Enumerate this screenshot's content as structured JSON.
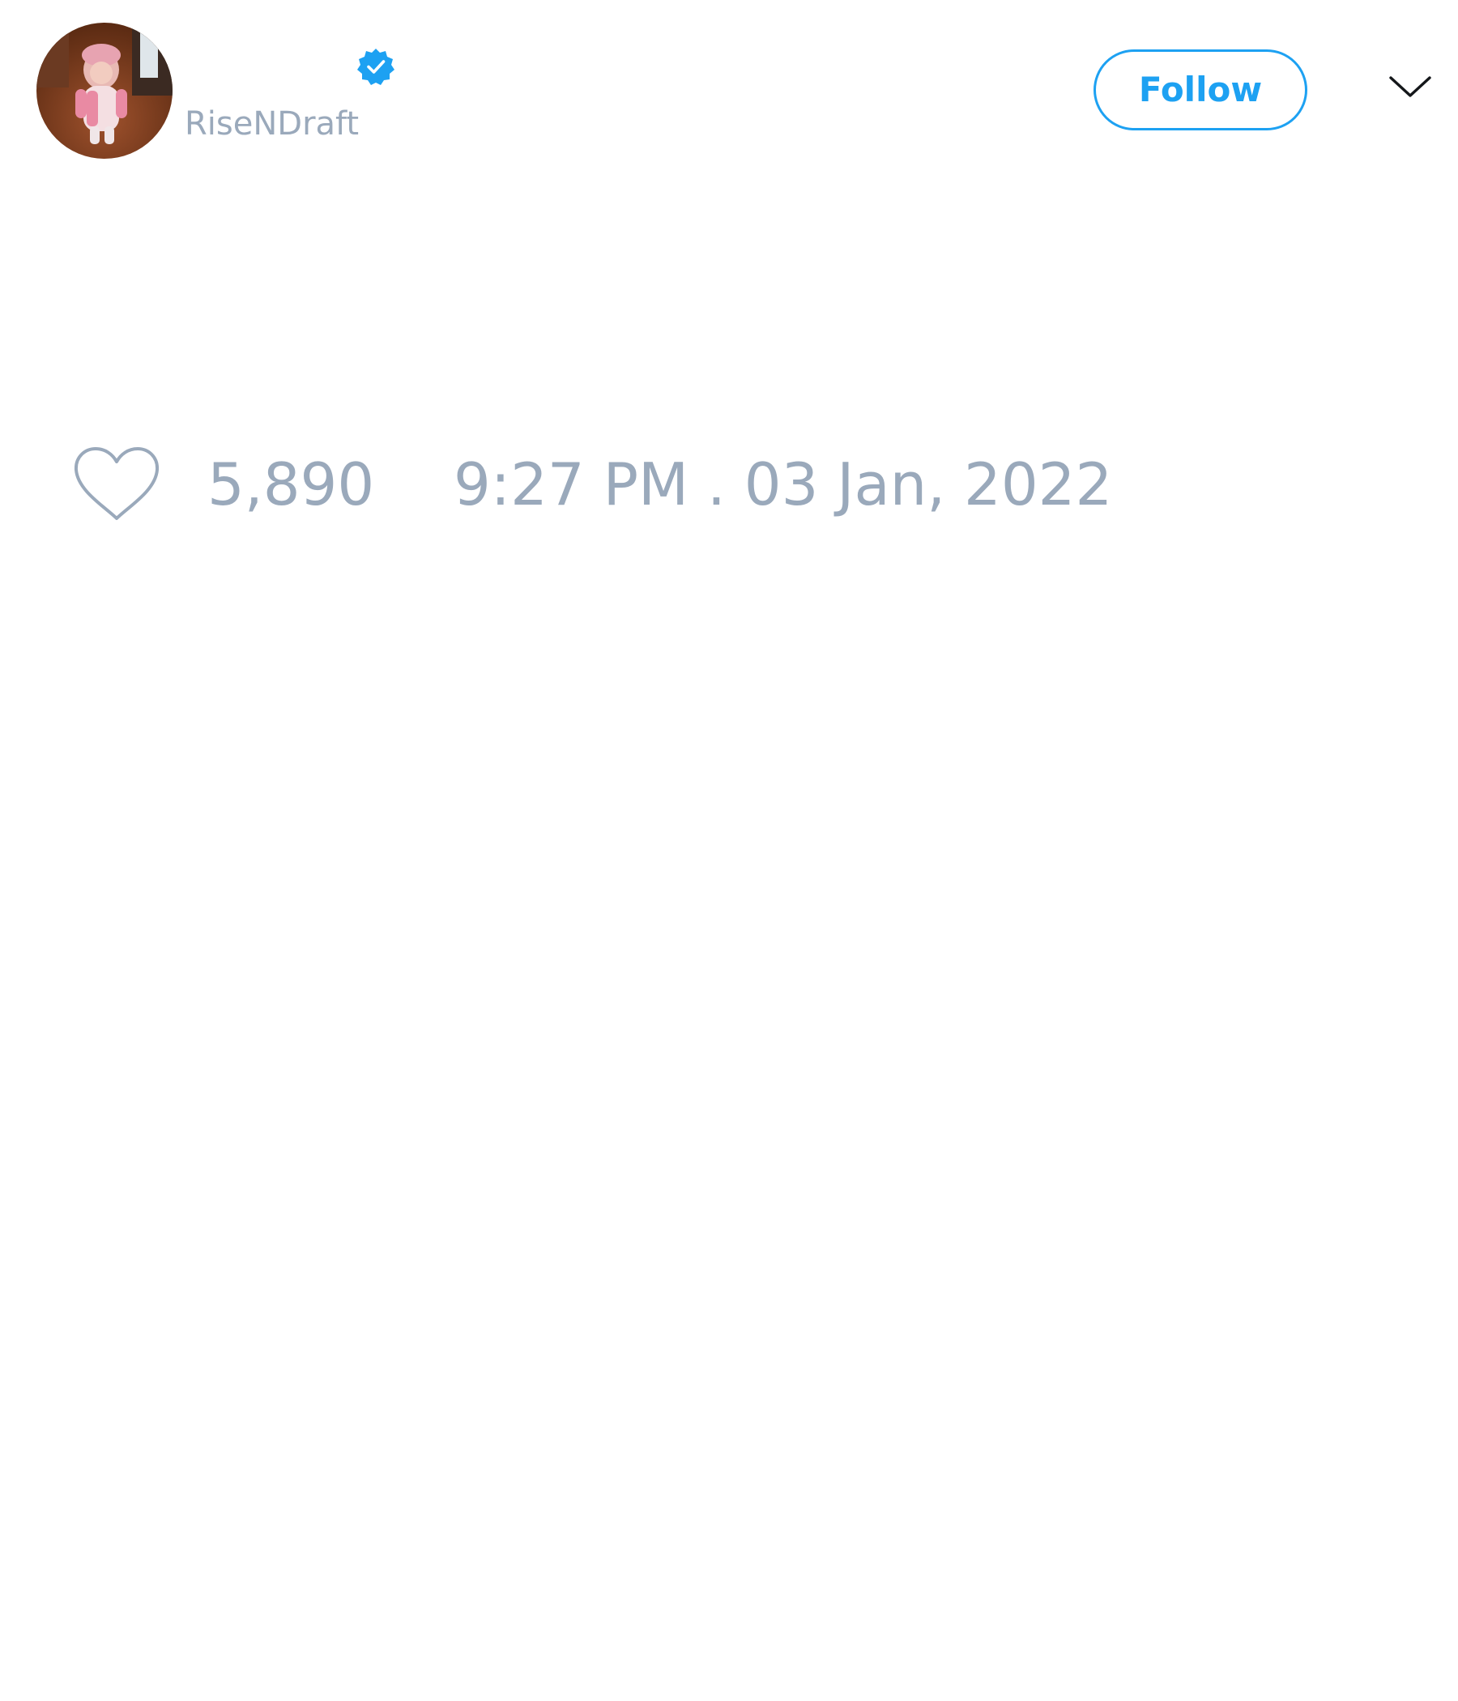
{
  "tweet": {
    "author": {
      "handle": "RiseNDraft",
      "verified": true,
      "avatar_icon": "profile-photo",
      "verified_icon": "verified-badge-icon"
    },
    "follow_button": {
      "label": "Follow"
    },
    "menu_icon": "chevron-down-icon",
    "footer": {
      "like_icon": "heart-icon",
      "like_count": "5,890",
      "timestamp": "9:27 PM . 03 Jan, 2022"
    }
  },
  "colors": {
    "accent": "#1da1f2",
    "muted_text": "#9aa9bb",
    "background": "#ffffff"
  }
}
